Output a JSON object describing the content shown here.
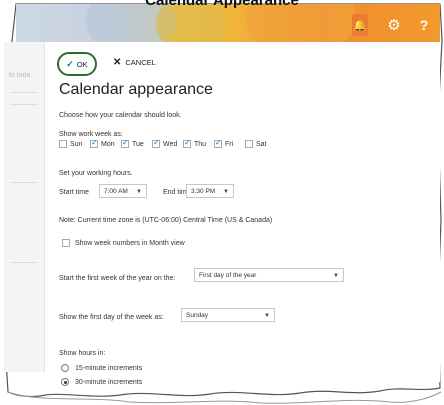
{
  "caption": "Calendar Appearance",
  "topbar": {
    "bell_glyph": "🔔",
    "gear_glyph": "⚙",
    "help_label": "?",
    "left_ghost_text": "to toda"
  },
  "actions": {
    "ok_label": "OK",
    "cancel_label": "CANCEL"
  },
  "dialog": {
    "title": "Calendar appearance",
    "intro": "Choose how your calendar should look.",
    "work_week_label": "Show work week as:",
    "days": [
      {
        "label": "Sun",
        "checked": false
      },
      {
        "label": "Mon",
        "checked": true
      },
      {
        "label": "Tue",
        "checked": true
      },
      {
        "label": "Wed",
        "checked": true
      },
      {
        "label": "Thu",
        "checked": true
      },
      {
        "label": "Fri",
        "checked": true
      },
      {
        "label": "Sat",
        "checked": false
      }
    ],
    "hours_label": "Set your working hours.",
    "start_time_label": "Start time",
    "start_time_value": "7:00 AM",
    "end_time_label": "End time",
    "end_time_value": "3:30 PM",
    "timezone_note": "Note: Current time zone is (UTC-06:00) Central Time (US & Canada)",
    "week_numbers_label": "Show week numbers in Month view",
    "week_numbers_checked": false,
    "first_week_label": "Start the first week of the year on the:",
    "first_week_value": "First day of the year",
    "first_day_label": "Show the first day of the week as:",
    "first_day_value": "Sunday",
    "show_hours_label": "Show hours in:",
    "increments": [
      {
        "label": "15-minute increments",
        "selected": false
      },
      {
        "label": "30-minute increments",
        "selected": true
      }
    ]
  },
  "colors": {
    "ok_border": "#2e6e2a",
    "check_accent": "#0078d4"
  }
}
